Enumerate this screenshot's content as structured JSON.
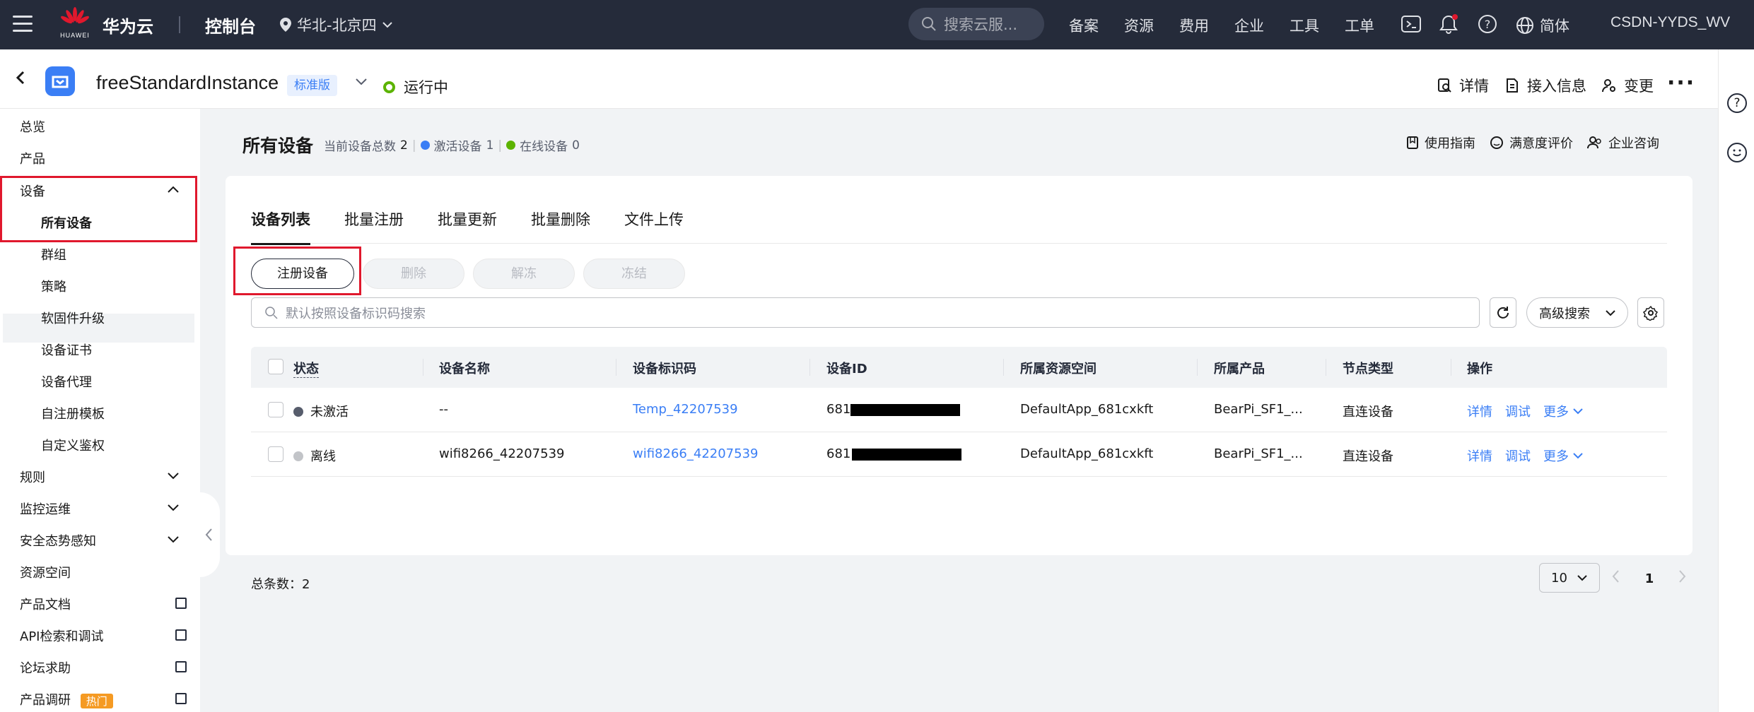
{
  "topbar": {
    "logo_text": "HUAWEI",
    "cloud_name": "华为云",
    "console": "控制台",
    "region": "华北-北京四",
    "search_placeholder": "搜索云服...",
    "nav": [
      "备案",
      "资源",
      "费用",
      "企业",
      "工具",
      "工单"
    ],
    "language": "简体",
    "user": "CSDN-YYDS_WV",
    "notification_dot_color": "#e0182d"
  },
  "instance": {
    "name": "freeStandardInstance",
    "edition": "标准版",
    "status": "运行中",
    "status_color": "#5cb300",
    "actions": {
      "details": "详情",
      "access_info": "接入信息",
      "change": "变更"
    },
    "more": "···"
  },
  "sidebar": {
    "items": [
      {
        "label": "总览"
      },
      {
        "label": "产品"
      },
      {
        "label": "设备"
      },
      {
        "label": "所有设备"
      },
      {
        "label": "群组"
      },
      {
        "label": "策略"
      },
      {
        "label": "软固件升级"
      },
      {
        "label": "设备证书"
      },
      {
        "label": "设备代理"
      },
      {
        "label": "自注册模板"
      },
      {
        "label": "自定义鉴权"
      },
      {
        "label": "规则"
      },
      {
        "label": "监控运维"
      },
      {
        "label": "安全态势感知"
      },
      {
        "label": "资源空间"
      },
      {
        "label": "产品文档"
      },
      {
        "label": "API检索和调试"
      },
      {
        "label": "论坛求助"
      },
      {
        "label": "产品调研"
      }
    ],
    "hot_badge": "热门"
  },
  "page": {
    "title": "所有设备",
    "stats": {
      "total_label": "当前设备总数",
      "total_value": "2",
      "active_label": "激活设备",
      "active_value": "1",
      "online_label": "在线设备",
      "online_value": "0"
    },
    "links": {
      "guide": "使用指南",
      "rating": "满意度评价",
      "consult": "企业咨询"
    }
  },
  "tabs": [
    "设备列表",
    "批量注册",
    "批量更新",
    "批量删除",
    "文件上传"
  ],
  "buttons": {
    "register": "注册设备",
    "delete": "删除",
    "unfreeze": "解冻",
    "freeze": "冻结"
  },
  "search": {
    "placeholder": "默认按照设备标识码搜索",
    "advanced": "高级搜索"
  },
  "table": {
    "headers": [
      "状态",
      "设备名称",
      "设备标识码",
      "设备ID",
      "所属资源空间",
      "所属产品",
      "节点类型",
      "操作"
    ],
    "rows": [
      {
        "status": "未激活",
        "status_color": "#575d6c",
        "name": "--",
        "node_id": "Temp_42207539",
        "device_id_prefix": "681",
        "space": "DefaultApp_681cxkft",
        "product": "BearPi_SF1_...",
        "node_type": "直连设备"
      },
      {
        "status": "离线",
        "status_color": "#c2c4c8",
        "name": "wifi8266_42207539",
        "node_id": "wifi8266_42207539",
        "device_id_prefix": "681",
        "space": "DefaultApp_681cxkft",
        "product": "BearPi_SF1_...",
        "node_type": "直连设备"
      }
    ],
    "ops": {
      "details": "详情",
      "debug": "调试",
      "more": "更多"
    }
  },
  "pagination": {
    "total_label": "总条数：2",
    "page_size": "10",
    "current_page": "1"
  }
}
